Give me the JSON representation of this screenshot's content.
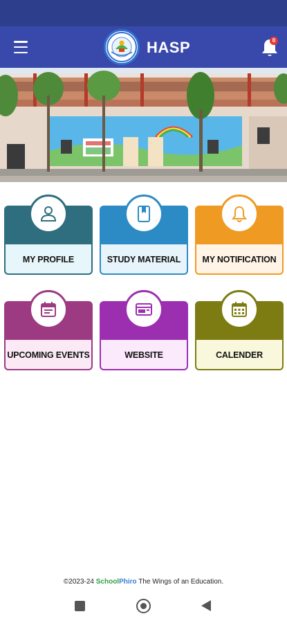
{
  "app": {
    "title": "HASP",
    "notification_count": "0"
  },
  "tiles": [
    {
      "label": "MY PROFILE",
      "icon": "person-icon",
      "color": "#2e6e7e",
      "bg": "#e7f6fa"
    },
    {
      "label": "STUDY MATERIAL",
      "icon": "book-icon",
      "color": "#2c8bc4",
      "bg": "#e8f4fb"
    },
    {
      "label": "MY NOTIFICATION",
      "icon": "bell-icon",
      "color": "#ef9a22",
      "bg": "#fff4e6"
    },
    {
      "label": "UPCOMING EVENTS",
      "icon": "event-icon",
      "color": "#9c3a82",
      "bg": "#fbeaf6"
    },
    {
      "label": "WEBSITE",
      "icon": "web-icon",
      "color": "#9b2fb0",
      "bg": "#fbe9fc"
    },
    {
      "label": "CALENDER",
      "icon": "calendar-icon",
      "color": "#7d7c12",
      "bg": "#f9f8dc"
    }
  ],
  "footer": {
    "copyright": "©2023-24 ",
    "brand_school": "School",
    "brand_phiro": "Phiro",
    "tagline": " The Wings of an Education."
  },
  "colors": {
    "status_bar": "#2c3e8c",
    "app_bar": "#3949ab",
    "badge": "#e53935"
  }
}
